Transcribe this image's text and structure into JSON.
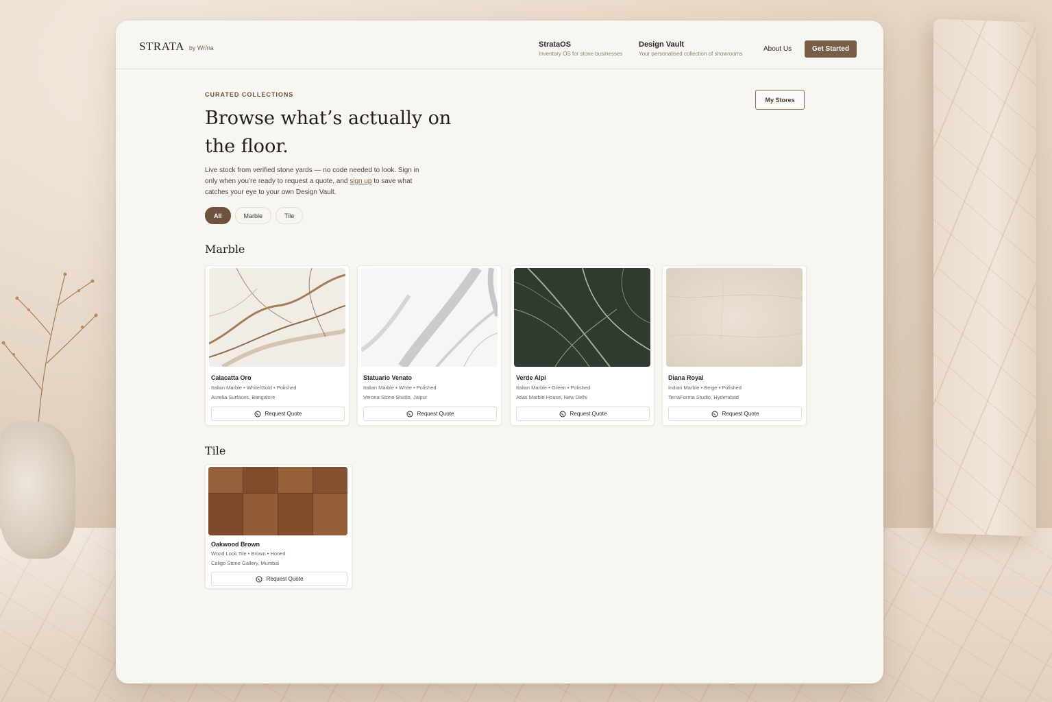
{
  "nav": {
    "logo": "STRATA",
    "logo_by": "by Wr/na",
    "strataos_title": "StrataOS",
    "strataos_sub": "Inventory OS for stone businesses",
    "vault_title": "Design Vault",
    "vault_sub": "Your personalised collection of showrooms",
    "about": "About Us",
    "get_started": "Get Started"
  },
  "hero": {
    "eyebrow": "CURATED COLLECTIONS",
    "headline": "Browse what’s actually on the floor.",
    "intro_before": "Live stock from verified stone yards — no code needed to look. Sign in only when you’re ready to request a quote, and ",
    "intro_link": "sign up",
    "intro_after": " to save what catches your eye to your own Design Vault.",
    "my_stores": "My Stores"
  },
  "filters": [
    "All",
    "Marble",
    "Tile"
  ],
  "sections": {
    "marble": {
      "title": "Marble",
      "cards": [
        {
          "name": "Calacatta Oro",
          "meta": "Italian Marble • White/Gold • Polished",
          "location": "Aurelia Surfaces, Bangalore",
          "cta": "Request Quote"
        },
        {
          "name": "Statuario Venato",
          "meta": "Italian Marble • White • Polished",
          "location": "Verona Stone Studio, Jaipur",
          "cta": "Request Quote"
        },
        {
          "name": "Verde Alpi",
          "meta": "Italian Marble • Green • Polished",
          "location": "Atlas Marble House, New Delhi",
          "cta": "Request Quote"
        },
        {
          "name": "Diana Royal",
          "meta": "Indian Marble • Beige • Polished",
          "location": "TerraForma Studio, Hyderabad",
          "cta": "Request Quote"
        }
      ]
    },
    "tile": {
      "title": "Tile",
      "cards": [
        {
          "name": "Oakwood Brown",
          "meta": "Wood Look Tile • Brown • Honed",
          "location": "Caligo Stone Gallery, Mumbai",
          "cta": "Request Quote"
        }
      ]
    }
  },
  "icons": {
    "quote_icon": "whatsapp-icon"
  },
  "colors": {
    "accent": "#7a5d45",
    "panel": "#f8f6f1",
    "text": "#231e1a"
  }
}
